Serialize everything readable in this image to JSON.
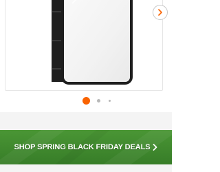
{
  "colors": {
    "accent": "#f96302",
    "banner_green": "#3f8a2f",
    "dot_inactive": "#b8b8b8",
    "frame_black": "#1e1e1e"
  },
  "carousel": {
    "next_icon": "chevron-right-icon",
    "active_index": 1,
    "total_visible_dots": 3
  },
  "promo_banner": {
    "label": "SHOP SPRING BLACK FRIDAY DEALS",
    "icon": "chevron-right-icon"
  }
}
